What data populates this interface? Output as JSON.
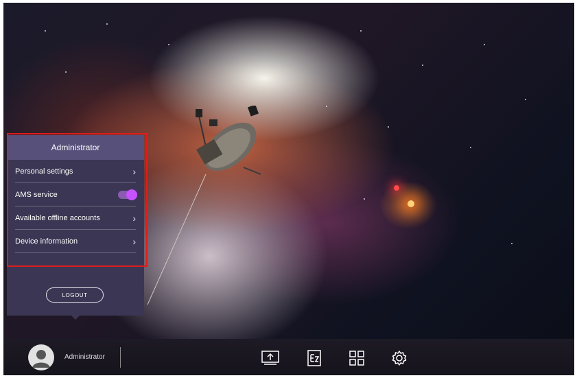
{
  "panel": {
    "title": "Administrator",
    "items": [
      {
        "label": "Personal settings",
        "control": "chevron"
      },
      {
        "label": "AMS service",
        "control": "toggle",
        "state": "on"
      },
      {
        "label": "Available offline accounts",
        "control": "chevron"
      },
      {
        "label": "Device information",
        "control": "chevron"
      }
    ],
    "logout_label": "LOGOUT"
  },
  "taskbar": {
    "user_name": "Administrator",
    "icons": [
      "screen-share-icon",
      "ez-write-icon",
      "apps-grid-icon",
      "settings-gear-icon"
    ]
  },
  "colors": {
    "panel_bg": "#3b3653",
    "panel_header": "#57507a",
    "toggle_accent": "#c752ff",
    "highlight_border": "#e01c1c"
  }
}
